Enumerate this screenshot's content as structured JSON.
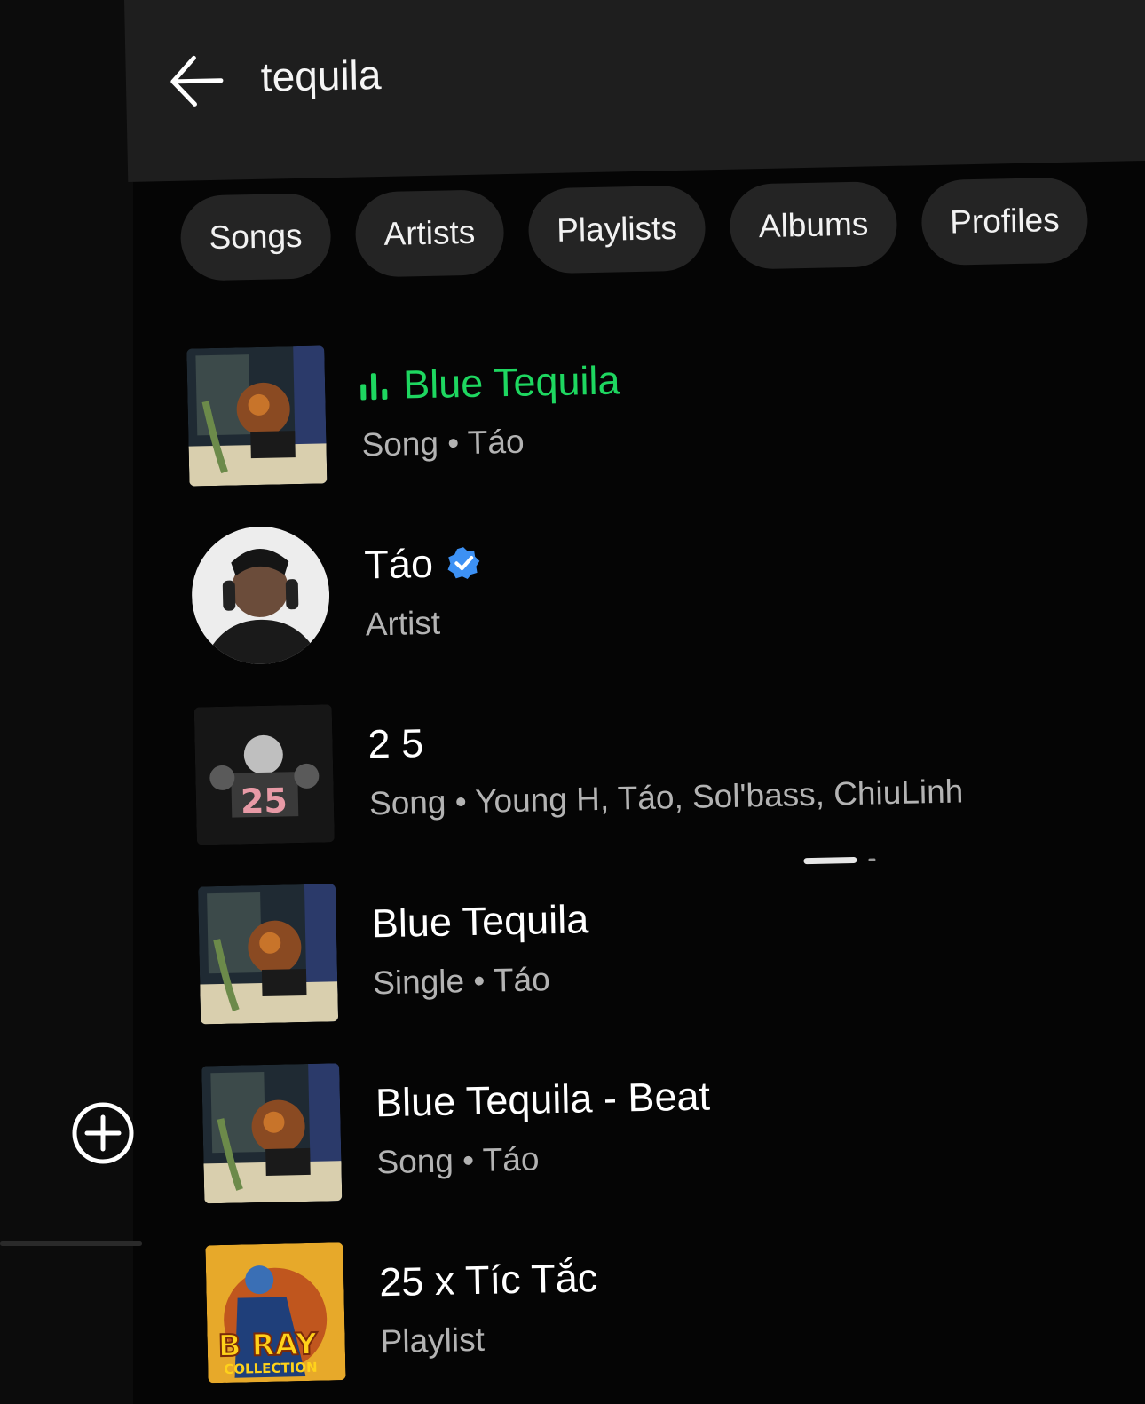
{
  "search": {
    "query": "tequila"
  },
  "filters": [
    "Songs",
    "Artists",
    "Playlists",
    "Albums",
    "Profiles"
  ],
  "results": [
    {
      "title": "Blue Tequila",
      "subtitle": "Song • Táo",
      "playing": true,
      "art": "blue-tequila-cover"
    },
    {
      "title": "Táo",
      "subtitle": "Artist",
      "verified": true,
      "art": "tao-artist-photo"
    },
    {
      "title": "2 5",
      "subtitle": "Song • Young H, Táo, Sol'bass, ChiuLinh",
      "art": "25-cover"
    },
    {
      "title": "Blue Tequila",
      "subtitle": "Single • Táo",
      "art": "blue-tequila-cover"
    },
    {
      "title": "Blue Tequila - Beat",
      "subtitle": "Song • Táo",
      "art": "blue-tequila-cover"
    },
    {
      "title": "25 x Tíc Tắc",
      "subtitle": "Playlist",
      "art": "bray-collection-cover"
    }
  ],
  "colors": {
    "accent": "#1ed760",
    "background": "#050505",
    "chip": "#242424",
    "verified": "#3d91f4"
  },
  "icons": {
    "back": "arrow-left-icon",
    "add": "plus-circle-icon",
    "verified": "verified-badge-icon",
    "playing": "equalizer-icon"
  }
}
